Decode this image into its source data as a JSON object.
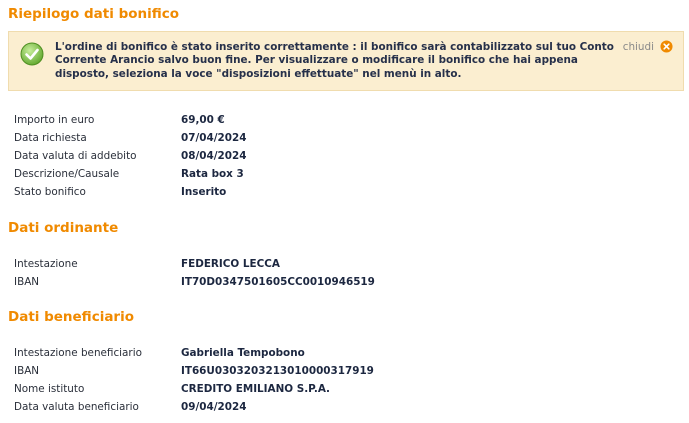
{
  "summary": {
    "title": "Riepilogo dati bonifico",
    "alert": {
      "message": "L'ordine di bonifico è stato inserito correttamente : il bonifico sarà contabilizzato sul tuo Conto Corrente Arancio salvo buon fine. Per visualizzare o modificare il bonifico che hai appena disposto, seleziona la voce \"disposizioni effettuate\" nel menù in alto.",
      "close_label": "chiudi"
    },
    "rows": [
      {
        "label": "Importo in euro",
        "value": "69,00 €"
      },
      {
        "label": "Data richiesta",
        "value": "07/04/2024"
      },
      {
        "label": "Data valuta di addebito",
        "value": "08/04/2024"
      },
      {
        "label": "Descrizione/Causale",
        "value": "Rata box 3"
      },
      {
        "label": "Stato bonifico",
        "value": "Inserito"
      }
    ]
  },
  "ordinante": {
    "title": "Dati ordinante",
    "rows": [
      {
        "label": "Intestazione",
        "value": "FEDERICO LECCA"
      },
      {
        "label": "IBAN",
        "value": "IT70D0347501605CC0010946519"
      }
    ]
  },
  "beneficiario": {
    "title": "Dati beneficiario",
    "rows": [
      {
        "label": "Intestazione beneficiario",
        "value": "Gabriella Tempobono"
      },
      {
        "label": "IBAN",
        "value": "IT66U0303203213010000317919"
      },
      {
        "label": "Nome istituto",
        "value": "CREDITO EMILIANO S.P.A."
      },
      {
        "label": "Data valuta beneficiario",
        "value": "09/04/2024"
      }
    ]
  },
  "colors": {
    "accent": "#f08a00",
    "alert_bg": "#fbeed0",
    "success": "#6fb33a",
    "close_icon": "#f08a00"
  },
  "icons": {
    "success": "check-circle-icon",
    "close": "close-circle-icon"
  }
}
